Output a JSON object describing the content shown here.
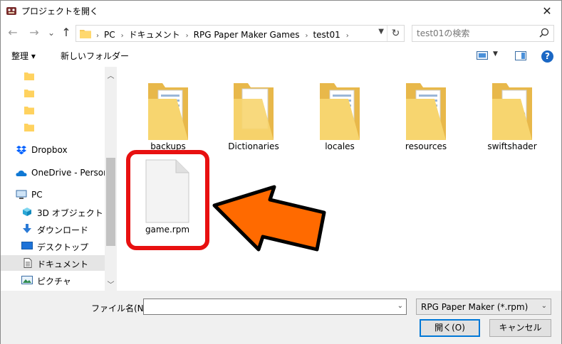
{
  "window": {
    "title": "プロジェクトを開く",
    "close_glyph": "✕"
  },
  "nav": {
    "back_glyph": "←",
    "forward_glyph": "→",
    "recent_glyph": "⌄",
    "up_glyph": "↑",
    "breadcrumbs": [
      "PC",
      "ドキュメント",
      "RPG Paper Maker Games",
      "test01"
    ],
    "breadcrumb_sep": "›",
    "refresh_glyph": "↻",
    "search_placeholder": "test01の検索"
  },
  "toolbar": {
    "organize_label": "整理 ▾",
    "new_folder_label": "新しいフォルダー",
    "help_label": "?"
  },
  "sidebar": {
    "items": [
      {
        "label": "",
        "icon": "folder-icon"
      },
      {
        "label": "",
        "icon": "folder-icon"
      },
      {
        "label": "",
        "icon": "folder-icon"
      },
      {
        "label": "",
        "icon": "folder-icon"
      },
      {
        "label": "Dropbox",
        "icon": "dropbox-icon"
      },
      {
        "label": "OneDrive - Persona",
        "icon": "onedrive-icon"
      },
      {
        "label": "PC",
        "icon": "pc-icon"
      },
      {
        "label": "3D オブジェクト",
        "icon": "3d-objects-icon"
      },
      {
        "label": "ダウンロード",
        "icon": "download-icon"
      },
      {
        "label": "デスクトップ",
        "icon": "desktop-icon"
      },
      {
        "label": "ドキュメント",
        "icon": "documents-icon",
        "selected": true
      },
      {
        "label": "ピクチャ",
        "icon": "pictures-icon"
      }
    ]
  },
  "files": [
    {
      "name": "backups",
      "type": "folder-docs"
    },
    {
      "name": "Dictionaries",
      "type": "folder-blank"
    },
    {
      "name": "locales",
      "type": "folder-docs"
    },
    {
      "name": "resources",
      "type": "folder-docs"
    },
    {
      "name": "swiftshader",
      "type": "folder-gear"
    },
    {
      "name": "game.rpm",
      "type": "file"
    }
  ],
  "annotation": {
    "highlight_color": "#e81010",
    "arrow_color": "#ff6a00"
  },
  "footer": {
    "filename_label": "ファイル名(N):",
    "filename_value": "",
    "filter_value": "RPG Paper Maker (*.rpm)",
    "open_label": "開く(O)",
    "cancel_label": "キャンセル"
  }
}
